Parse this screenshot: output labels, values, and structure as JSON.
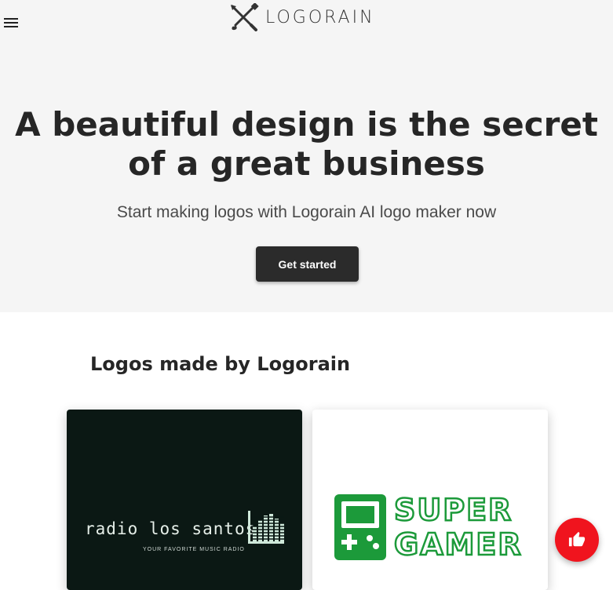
{
  "header": {
    "menu_icon": "hamburger-menu-icon",
    "logo_text": "LOGORAIN",
    "logo_icon": "pencil-brush-cross-icon"
  },
  "hero": {
    "headline_line1": "A beautiful design is the secret",
    "headline_line2": "of a great business",
    "subheadline": "Start making logos with Logorain AI logo maker now",
    "cta_label": "Get started"
  },
  "showcase": {
    "title": "Logos made by Logorain",
    "logos": [
      {
        "name": "radio los santos",
        "tagline": "YOUR FAVORITE MUSIC RADIO",
        "background": "#0b1814"
      },
      {
        "line1": "SUPER",
        "line2": "GAMER",
        "background": "#ffffff",
        "accent": "#1c9a3a"
      }
    ]
  },
  "fab": {
    "icon": "thumbs-up-icon",
    "color": "#f0141e"
  },
  "colors": {
    "hero_bg": "#f5f5f5",
    "button_bg": "#2b2b2b",
    "page_bg": "#ffffff"
  }
}
